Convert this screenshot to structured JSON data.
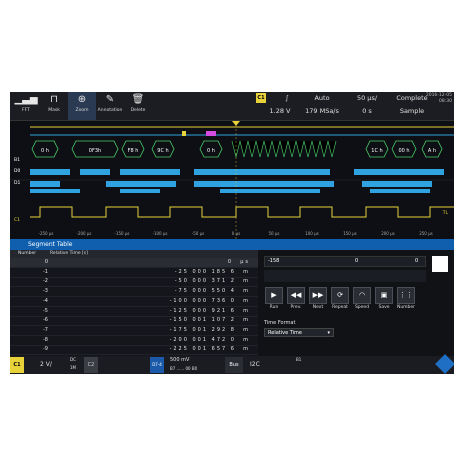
{
  "toolbar": {
    "buttons": [
      {
        "label": "FFT",
        "icon": "fft-icon",
        "glyph": "▁▃▅"
      },
      {
        "label": "Mask",
        "icon": "mask-icon",
        "glyph": "⊓"
      },
      {
        "label": "Zoom",
        "icon": "zoom-icon",
        "glyph": "⊕"
      },
      {
        "label": "Annotation",
        "icon": "pen-icon",
        "glyph": "✎"
      },
      {
        "label": "Delete",
        "icon": "trash-icon",
        "glyph": "🗑"
      }
    ]
  },
  "header": {
    "channel": "C1",
    "slope": "∫",
    "level": "1.28 V",
    "trigger_mode": "Auto",
    "sample_rate": "179 MSa/s",
    "time_per_div": "50 µs/",
    "offset": "0 s",
    "acquisition": "Complete",
    "acq_mode": "Sample",
    "date": "2016-12-05",
    "time": "08:30"
  },
  "waveform": {
    "decode_labels": [
      "0 h",
      "0F3h",
      "F8 h",
      "9C h",
      "0 h",
      "1C h",
      "00 h",
      "A h"
    ],
    "x_ticks": [
      "-250 µs",
      "-200 µs",
      "-150 µs",
      "-100 µs",
      "-50 µs",
      "0 µs",
      "50 µs",
      "100 µs",
      "150 µs",
      "200 µs",
      "250 µs"
    ],
    "right_labels": [
      "B1",
      "D0",
      "D1",
      "C1",
      "TL"
    ],
    "colors": {
      "ch1": "#e8d23a",
      "digital": "#2ea3e0",
      "decode": "#4ad26a",
      "bus_marker": "#d64ce0"
    }
  },
  "segment_table": {
    "title": "Segment Table",
    "col_number": "Number",
    "col_time": "Relative Time [s]",
    "rows": [
      {
        "num": "0",
        "time": "0  µs"
      },
      {
        "num": "-1",
        "time": "-25 000 185 6  m"
      },
      {
        "num": "-2",
        "time": "-50 000 371 2  m"
      },
      {
        "num": "-3",
        "time": "-75 000 550 4  m"
      },
      {
        "num": "-4",
        "time": "-100 000 736 0  m"
      },
      {
        "num": "-5",
        "time": "-125 000 921 6  m"
      },
      {
        "num": "-6",
        "time": "-150 001 107 2  m"
      },
      {
        "num": "-7",
        "time": "-175 001 292 8  m"
      },
      {
        "num": "-8",
        "time": "-200 001 472 0  m"
      },
      {
        "num": "-9",
        "time": "-225 001 657 6  m"
      }
    ]
  },
  "right_panel": {
    "segment_left": "-158",
    "segment_mid": "0",
    "segment_right": "0",
    "controls": [
      {
        "label": "Run",
        "icon": "play-icon",
        "glyph": "▶"
      },
      {
        "label": "Prev.",
        "icon": "rewind-icon",
        "glyph": "◀◀"
      },
      {
        "label": "Next",
        "icon": "forward-icon",
        "glyph": "▶▶"
      },
      {
        "label": "Repeat",
        "icon": "repeat-icon",
        "glyph": "⟳"
      },
      {
        "label": "Speed",
        "icon": "speed-icon",
        "glyph": "◠"
      },
      {
        "label": "Save",
        "icon": "save-icon",
        "glyph": "▣"
      },
      {
        "label": "Number",
        "icon": "grid-icon",
        "glyph": "⋮⋮"
      }
    ],
    "time_format_label": "Time Format",
    "time_format_value": "Relative Time"
  },
  "bottom": {
    "ch1": "C1",
    "ch1_scale": "2 V/",
    "ch1_coupling": "DC",
    "ch1_bw": "1M",
    "c2": "C2",
    "d74": "D7-4",
    "d_level": "500 mV",
    "d_bits": "B7 ...... 00 B0",
    "bus": "Bus",
    "bus_type": "I2C",
    "bus_id": "B1"
  }
}
